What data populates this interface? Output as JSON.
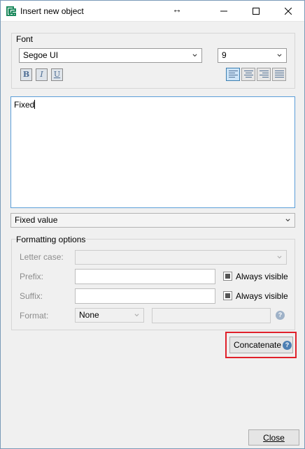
{
  "window": {
    "title": "Insert new object"
  },
  "font": {
    "group_label": "Font",
    "family": "Segoe UI",
    "size": "9",
    "bold": "B",
    "italic": "I",
    "underline": "U"
  },
  "editor": {
    "text": "Fixed"
  },
  "source": {
    "selected": "Fixed value"
  },
  "formatting": {
    "group_label": "Formatting options",
    "letter_case_label": "Letter case:",
    "letter_case_value": "",
    "prefix_label": "Prefix:",
    "suffix_label": "Suffix:",
    "always_visible_prefix": "Always visible",
    "always_visible_suffix": "Always visible",
    "format_label": "Format:",
    "format_value": "None"
  },
  "actions": {
    "concatenate": "Concatenate",
    "close": "Close"
  },
  "colors": {
    "accent": "#3c7fb1",
    "highlight": "#e0202a"
  }
}
